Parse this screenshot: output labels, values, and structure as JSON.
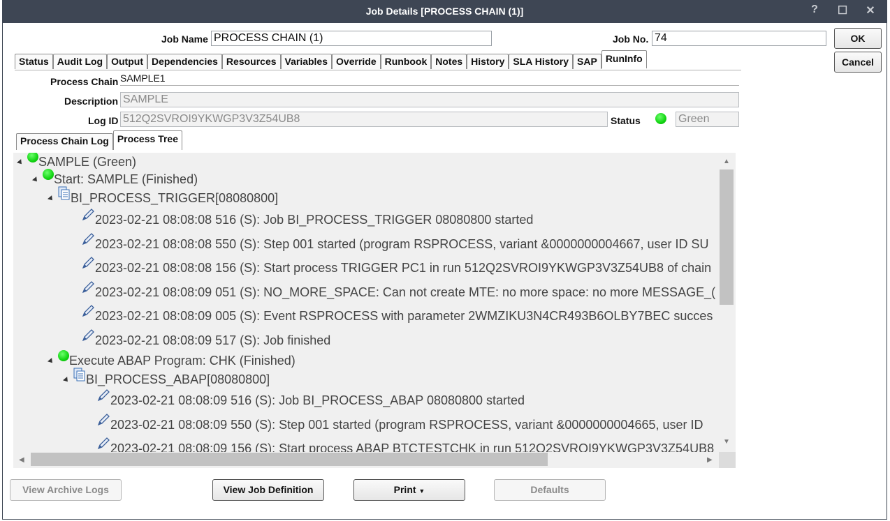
{
  "window": {
    "title": "Job Details [PROCESS CHAIN (1)]",
    "icons": [
      "help-icon",
      "maximize-icon",
      "close-icon"
    ],
    "help_glyph": "?",
    "max_glyph": "☐",
    "close_glyph": "✕"
  },
  "header": {
    "job_name_label": "Job Name",
    "job_name_value": "PROCESS CHAIN (1)",
    "job_no_label": "Job No.",
    "job_no_value": "74",
    "ok_label": "OK",
    "cancel_label": "Cancel"
  },
  "tabs": [
    "Status",
    "Audit Log",
    "Output",
    "Dependencies",
    "Resources",
    "Variables",
    "Override",
    "Runbook",
    "Notes",
    "History",
    "SLA History",
    "SAP",
    "RunInfo"
  ],
  "active_tab": "RunInfo",
  "runinfo": {
    "process_chain_label": "Process Chain",
    "process_chain_value": "SAMPLE1",
    "description_label": "Description",
    "description_value": "SAMPLE",
    "log_id_label": "Log ID",
    "log_id_value": "512Q2SVROI9YKWGP3V3Z54UB8",
    "status_label": "Status",
    "status_value": "Green",
    "status_color": "#11d411"
  },
  "subtabs": [
    "Process Chain Log",
    "Process Tree"
  ],
  "active_subtab": "Process Tree",
  "tree": [
    {
      "text": "SAMPLE (Green)",
      "icon": "green-dot"
    },
    {
      "text": "Start: SAMPLE (Finished)",
      "icon": "green-dot"
    },
    {
      "text": "BI_PROCESS_TRIGGER[08080800]",
      "icon": "document-icon"
    },
    {
      "text": "2023-02-21 08:08:08 516 (S): Job BI_PROCESS_TRIGGER 08080800 started",
      "icon": "pencil-icon"
    },
    {
      "text": "2023-02-21 08:08:08 550 (S): Step 001 started (program RSPROCESS, variant &0000000004667, user ID SU",
      "icon": "pencil-icon"
    },
    {
      "text": "2023-02-21 08:08:08 156 (S): Start process TRIGGER PC1 in run 512Q2SVROI9YKWGP3V3Z54UB8 of chain",
      "icon": "pencil-icon"
    },
    {
      "text": "2023-02-21 08:08:09 051 (S): NO_MORE_SPACE: Can not create MTE: no more space: no more MESSAGE_(",
      "icon": "pencil-icon"
    },
    {
      "text": "2023-02-21 08:08:09 005 (S): Event RSPROCESS with parameter 2WMZIKU3N4CR493B6OLBY7BEC succes",
      "icon": "pencil-icon"
    },
    {
      "text": "2023-02-21 08:08:09 517 (S): Job finished",
      "icon": "pencil-icon"
    },
    {
      "text": "Execute ABAP Program: CHK (Finished)",
      "icon": "green-dot"
    },
    {
      "text": "BI_PROCESS_ABAP[08080800]",
      "icon": "document-icon"
    },
    {
      "text": "2023-02-21 08:08:09 516 (S): Job BI_PROCESS_ABAP 08080800 started",
      "icon": "pencil-icon"
    },
    {
      "text": "2023-02-21 08:08:09 550 (S): Step 001 started (program RSPROCESS, variant &0000000004665, user ID",
      "icon": "pencil-icon"
    },
    {
      "text": "2023-02-21 08:08:09 156 (S): Start process ABAP BTCTESTCHK in run 512Q2SVROI9YKWGP3V3Z54UB8",
      "icon": "pencil-icon"
    }
  ],
  "footer": {
    "view_archive_logs": "View Archive Logs",
    "view_job_definition": "View Job Definition",
    "print": "Print",
    "defaults": "Defaults"
  }
}
